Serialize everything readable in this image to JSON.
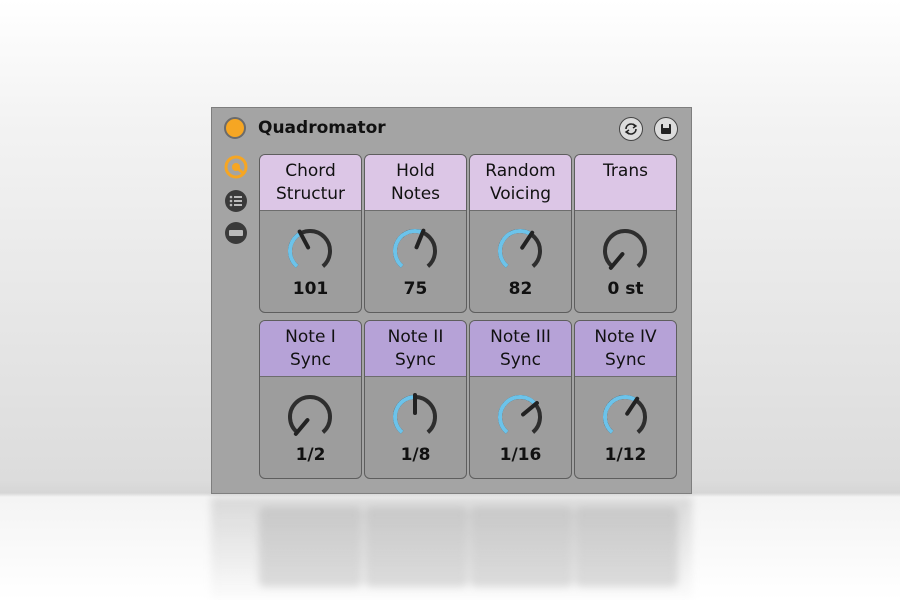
{
  "device": {
    "title": "Quadromator",
    "header_icons": [
      "hot-swap-icon",
      "save-preset-icon"
    ],
    "side_icons": [
      "macro-map-icon",
      "list-icon",
      "bar-icon"
    ]
  },
  "macros": [
    {
      "label1": "Chord",
      "label2": "Structur",
      "value": "101",
      "level": 0.4,
      "header_color": "#dcc6e6",
      "arc_color": "#6cc3ea"
    },
    {
      "label1": "Hold",
      "label2": "Notes",
      "value": "75",
      "level": 0.58,
      "header_color": "#dcc6e6",
      "arc_color": "#6cc3ea"
    },
    {
      "label1": "Random",
      "label2": "Voicing",
      "value": "82",
      "level": 0.62,
      "header_color": "#dcc6e6",
      "arc_color": "#6cc3ea"
    },
    {
      "label1": "Trans",
      "label2": "",
      "value": "0 st",
      "level": 0.0,
      "header_color": "#dcc6e6",
      "arc_color": "#6cc3ea"
    },
    {
      "label1": "Note I",
      "label2": "Sync",
      "value": "1/2",
      "level": 0.0,
      "header_color": "#b6a2d7",
      "arc_color": "#6cc3ea"
    },
    {
      "label1": "Note II",
      "label2": "Sync",
      "value": "1/8",
      "level": 0.5,
      "header_color": "#b6a2d7",
      "arc_color": "#6cc3ea"
    },
    {
      "label1": "Note III",
      "label2": "Sync",
      "value": "1/16",
      "level": 0.68,
      "header_color": "#b6a2d7",
      "arc_color": "#6cc3ea"
    },
    {
      "label1": "Note IV",
      "label2": "Sync",
      "value": "1/12",
      "level": 0.62,
      "header_color": "#b6a2d7",
      "arc_color": "#6cc3ea"
    }
  ],
  "colors": {
    "power": "#f6a623",
    "side_active": "#f6a623",
    "knob_track": "#2e2e2e"
  }
}
